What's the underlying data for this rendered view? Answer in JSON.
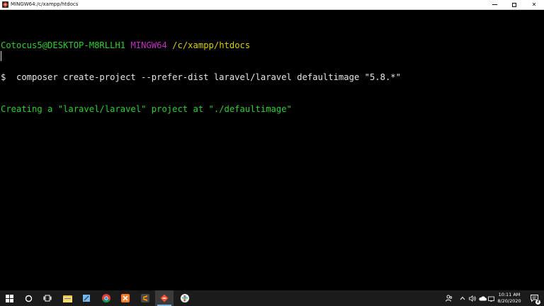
{
  "window": {
    "title": "MINGW64:/c/xampp/htdocs"
  },
  "terminal": {
    "prompt": {
      "user_host": "Cotocus5@DESKTOP-M8RLLH1",
      "shell": "MINGW64",
      "path": "/c/xampp/htdocs"
    },
    "command_line": "$  composer create-project --prefer-dist laravel/laravel defaultimage \"5.8.*\"",
    "output_line": "Creating a \"laravel/laravel\" project at \"./defaultimage\"",
    "colors": {
      "background": "#000000",
      "user_host": "#2fcf2f",
      "shell": "#c030c0",
      "path": "#d6d000",
      "command": "#e6e6e6",
      "output": "#2fcf2f"
    }
  },
  "taskbar": {
    "pinned": [
      "start-icon",
      "search-icon",
      "task-view-icon",
      "file-explorer-icon",
      "notepad-icon",
      "chrome-icon",
      "xampp-icon",
      "sublime-text-icon",
      "git-bash-icon",
      "slack-icon"
    ],
    "tray_icons": [
      "people-icon",
      "chevron-up-icon",
      "volume-icon",
      "onedrive-icon",
      "network-icon"
    ],
    "time": "10:11 AM",
    "date": "8/20/2020",
    "notification_count": "2"
  }
}
